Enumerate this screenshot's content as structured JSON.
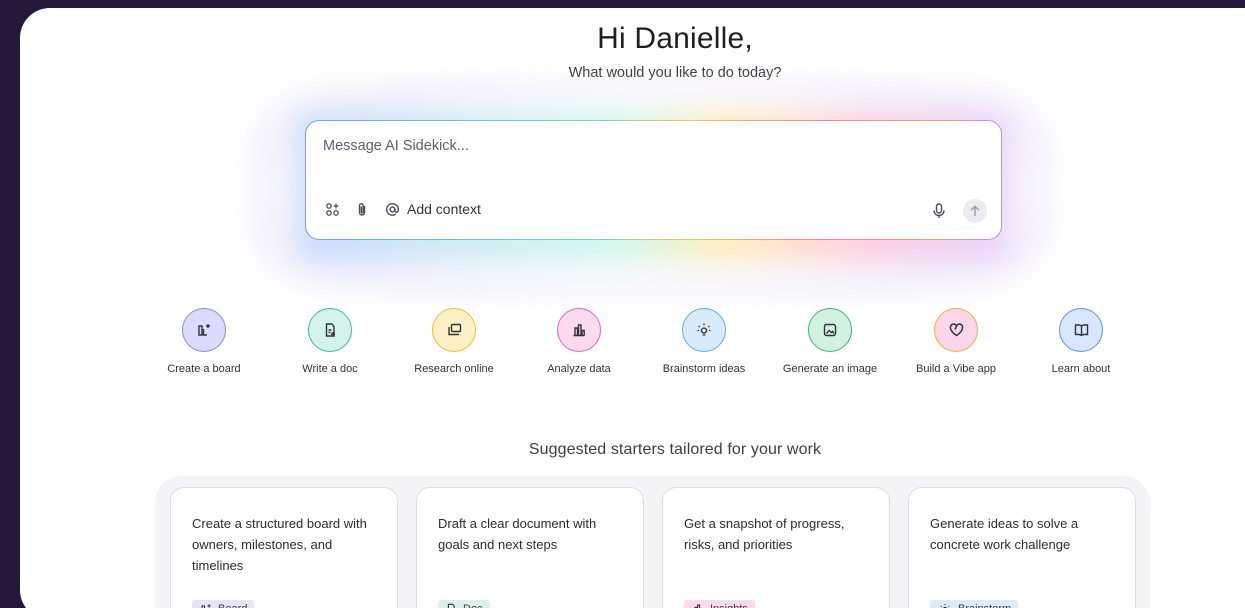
{
  "greeting": "Hi Danielle,",
  "subgreeting": "What would you like to do today?",
  "prompt": {
    "placeholder": "Message AI Sidekick...",
    "add_context_label": "Add context",
    "icons": [
      "tools-icon",
      "attach-icon",
      "at-icon",
      "mic-icon",
      "send-icon"
    ]
  },
  "actions": [
    {
      "label": "Create a board",
      "icon": "board-icon",
      "color": "#8b86f0",
      "bg": "#dcdbff"
    },
    {
      "label": "Write a doc",
      "icon": "doc-icon",
      "color": "#3cb8a3",
      "bg": "#d3f2ec"
    },
    {
      "label": "Research online",
      "icon": "research-icon",
      "color": "#f2be33",
      "bg": "#fdefc6"
    },
    {
      "label": "Analyze data",
      "icon": "chart-icon",
      "color": "#e068b4",
      "bg": "#fbd9ee"
    },
    {
      "label": "Brainstorm ideas",
      "icon": "bulb-icon",
      "color": "#5fa8e8",
      "bg": "#d8ebfb"
    },
    {
      "label": "Generate an image",
      "icon": "image-icon",
      "color": "#3fb07a",
      "bg": "#d3f1e1"
    },
    {
      "label": "Build a Vibe app",
      "icon": "heart-icon",
      "color": "#f0b23a",
      "bg": "#fbd6ea"
    },
    {
      "label": "Learn about",
      "icon": "book-icon",
      "color": "#5b8ef0",
      "bg": "#d9e6ff"
    }
  ],
  "suggested_title": "Suggested starters tailored for your work",
  "cards": [
    {
      "text": "Create a structured board with owners, milestones, and timelines",
      "tag": "Board",
      "tag_icon": "board-icon",
      "tag_bg": "#e6e4fb"
    },
    {
      "text": "Draft a clear document with goals and next steps",
      "tag": "Doc",
      "tag_icon": "doc-icon",
      "tag_bg": "#dcf1ec"
    },
    {
      "text": "Get a snapshot of progress, risks, and priorities",
      "tag": "Insights",
      "tag_icon": "chart-icon",
      "tag_bg": "#fbdaed"
    },
    {
      "text": "Generate ideas to solve a concrete work challenge",
      "tag": "Brainstorm",
      "tag_icon": "bulb-icon",
      "tag_bg": "#dcebf8"
    }
  ]
}
